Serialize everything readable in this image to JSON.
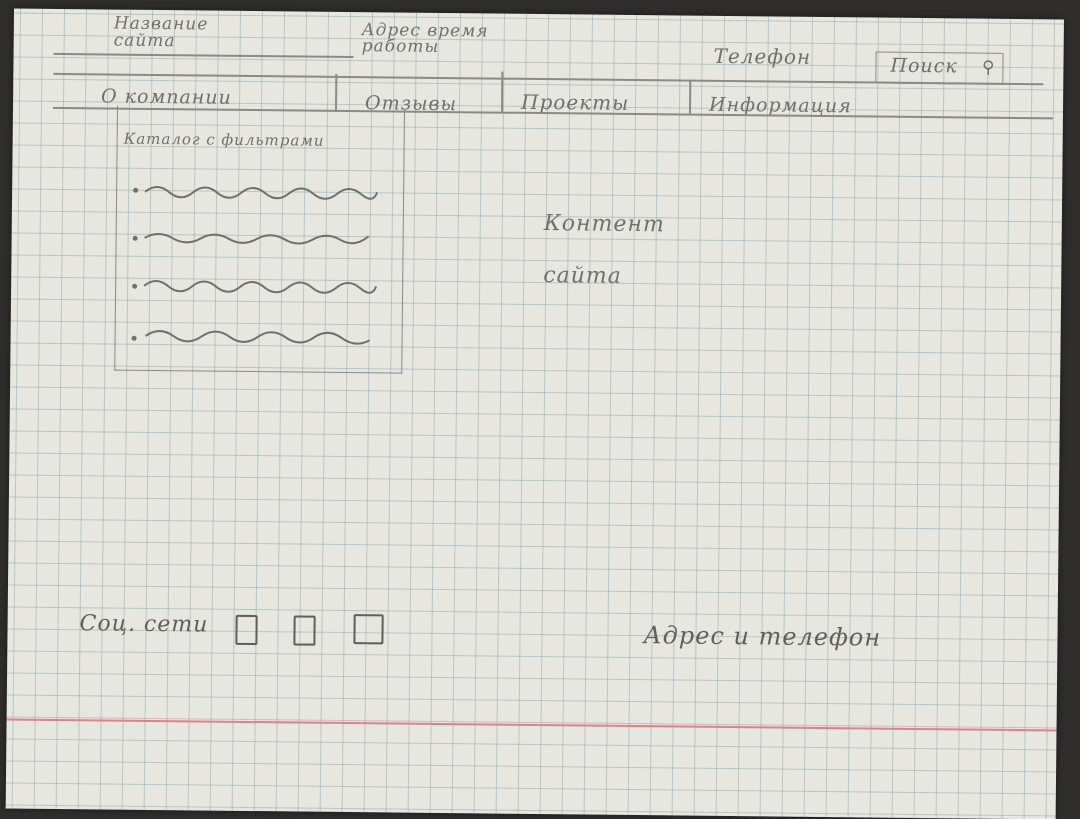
{
  "header": {
    "site_name": "Название сайта",
    "address_hours": "Адрес время работы",
    "phone": "Телефон",
    "search": "Поиск"
  },
  "nav": {
    "items": [
      "О компании",
      "Отзывы",
      "Проекты",
      "Информация"
    ]
  },
  "sidebar": {
    "title": "Каталог с фильтрами",
    "item_count": 4
  },
  "main": {
    "content_label": "Контент сайта"
  },
  "footer": {
    "social_label": "Соц. сети",
    "social_icons": [
      "social-link-1",
      "social-link-2",
      "social-link-3"
    ],
    "contacts": "Адрес и телефон"
  },
  "colors": {
    "paper": "#e7e6df",
    "grid": "#78a0af",
    "pencil": "#6f6f6c",
    "margin_line": "#e67d8c"
  }
}
